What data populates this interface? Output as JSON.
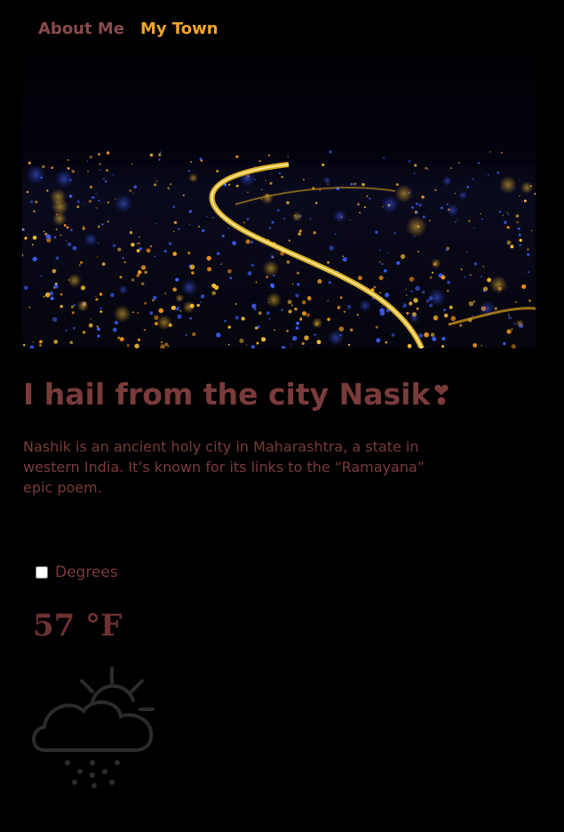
{
  "nav": {
    "items": [
      {
        "label": "About Me"
      },
      {
        "label": "My Town"
      }
    ]
  },
  "hero": {
    "icon": "city-night-photo"
  },
  "main": {
    "headline": "I hail from the city Nasik",
    "headline_mark": "❣",
    "description": "Nashik is an ancient holy city in Maharashtra, a state in western India. It’s known for its links to the “Ramayana” epic poem."
  },
  "weather": {
    "toggle_label": "Degrees",
    "toggle_checked": false,
    "temperature": "57 °F",
    "icon": "cloud-sun-snow-icon"
  },
  "colors": {
    "background": "#000000",
    "text": "#7a3b3b",
    "nav_active": "#f2a52b",
    "icon_stroke": "#2b2b2b"
  }
}
